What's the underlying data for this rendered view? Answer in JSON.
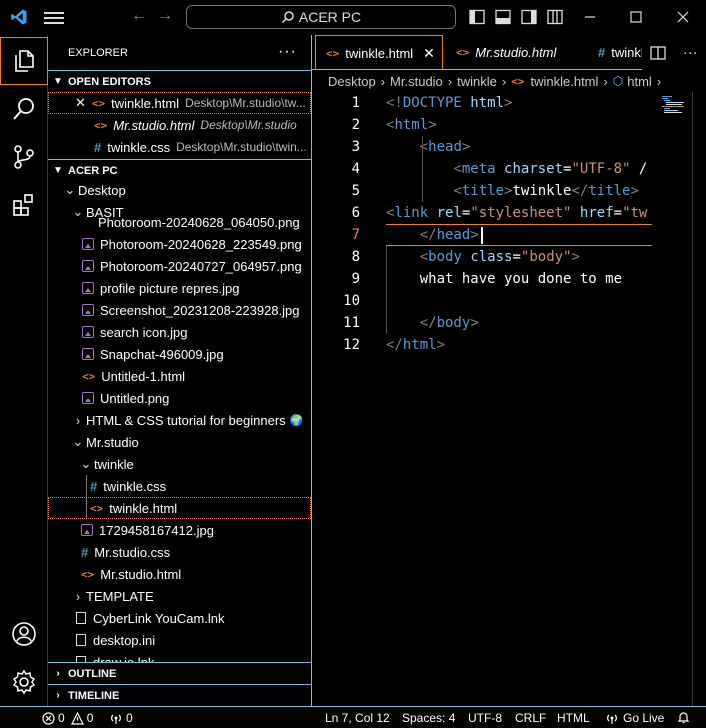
{
  "titlebar": {
    "search_text": "ACER PC"
  },
  "sidebar": {
    "title": "EXPLORER",
    "more": "···",
    "open_editors_label": "OPEN EDITORS",
    "open_editors": [
      {
        "name": "twinkle.html",
        "path": "Desktop\\Mr.studio\\tw...",
        "type": "html",
        "close": "✕"
      },
      {
        "name": "Mr.studio.html",
        "path": "Desktop\\Mr.studio",
        "type": "html"
      },
      {
        "name": "twinkle.css",
        "path": "Desktop\\Mr.studio\\twin...",
        "type": "css"
      }
    ],
    "workspace_label": "ACER PC",
    "tree": {
      "desktop": "Desktop",
      "basit": "BASIT",
      "basit_cut": "Photoroom-20240628_064050.png",
      "files1": [
        {
          "name": "Photoroom-20240628_223549.png",
          "type": "img"
        },
        {
          "name": "Photoroom-20240727_064957.png",
          "type": "img"
        },
        {
          "name": "profile picture repres.jpg",
          "type": "img"
        },
        {
          "name": "Screenshot_20231208-223928.jpg",
          "type": "img"
        },
        {
          "name": "search icon.jpg",
          "type": "img"
        },
        {
          "name": "Snapchat-496009.jpg",
          "type": "img"
        },
        {
          "name": "Untitled-1.html",
          "type": "html"
        },
        {
          "name": "Untitled.png",
          "type": "img"
        }
      ],
      "html_css_folder": "HTML & CSS tutorial for beginners",
      "globe": "🌍",
      "mrstudio": "Mr.studio",
      "twinkle_folder": "twinkle",
      "twinkle_css": "twinkle.css",
      "twinkle_html": "twinkle.html",
      "files2": [
        {
          "name": "1729458167412.jpg",
          "type": "img"
        },
        {
          "name": "Mr.studio.css",
          "type": "css"
        },
        {
          "name": "Mr.studio.html",
          "type": "html"
        }
      ],
      "template": "TEMPLATE",
      "files3": [
        {
          "name": "CyberLink YouCam.lnk",
          "type": "lnk"
        },
        {
          "name": "desktop.ini",
          "type": "ini"
        },
        {
          "name": "draw.io.lnk",
          "type": "lnk"
        }
      ]
    },
    "outline_label": "OUTLINE",
    "timeline_label": "TIMELINE"
  },
  "tabs": [
    {
      "label": "twinkle.html",
      "active": true,
      "close": "✕"
    },
    {
      "label": "Mr.studio.html",
      "active": false
    },
    {
      "label": "twinkle.css",
      "active": false
    }
  ],
  "breadcrumb": [
    "Desktop",
    "Mr.studio",
    "twinkle",
    "twinkle.html",
    "html"
  ],
  "breadcrumb_sep": "›",
  "editor": {
    "line_numbers": [
      "1",
      "2",
      "3",
      "4",
      "5",
      "6",
      "7",
      "8",
      "9",
      "10",
      "11",
      "12"
    ],
    "current_line": 7,
    "lines": [
      [
        [
          "br",
          "<!"
        ],
        [
          "tag",
          "DOCTYPE "
        ],
        [
          "attr",
          "html"
        ],
        [
          "br",
          ">"
        ]
      ],
      [
        [
          "br",
          "<"
        ],
        [
          "tag",
          "html"
        ],
        [
          "br",
          ">"
        ]
      ],
      [
        [
          "txt",
          "    "
        ],
        [
          "br",
          "<"
        ],
        [
          "tag",
          "head"
        ],
        [
          "br",
          ">"
        ]
      ],
      [
        [
          "txt",
          "        "
        ],
        [
          "br",
          "<"
        ],
        [
          "tag",
          "meta "
        ],
        [
          "attr",
          "charset"
        ],
        [
          "txt",
          "="
        ],
        [
          "str",
          "\"UTF-8\""
        ],
        [
          "txt",
          " /"
        ]
      ],
      [
        [
          "txt",
          "        "
        ],
        [
          "br",
          "<"
        ],
        [
          "tag",
          "title"
        ],
        [
          "br",
          ">"
        ],
        [
          "txt",
          "twinkle"
        ],
        [
          "br",
          "</"
        ],
        [
          "tag",
          "title"
        ],
        [
          "br",
          ">"
        ]
      ],
      [
        [
          "br",
          "<"
        ],
        [
          "tag",
          "link "
        ],
        [
          "attr",
          "rel"
        ],
        [
          "txt",
          "="
        ],
        [
          "str",
          "\"stylesheet\""
        ],
        [
          "txt",
          " "
        ],
        [
          "attr",
          "href"
        ],
        [
          "txt",
          "="
        ],
        [
          "str",
          "\"tw"
        ]
      ],
      [
        [
          "txt",
          "    "
        ],
        [
          "br",
          "</"
        ],
        [
          "tag",
          "head"
        ],
        [
          "br",
          ">"
        ]
      ],
      [
        [
          "txt",
          "    "
        ],
        [
          "br",
          "<"
        ],
        [
          "tag",
          "body "
        ],
        [
          "attr",
          "class"
        ],
        [
          "txt",
          "="
        ],
        [
          "str",
          "\"body\""
        ],
        [
          "br",
          ">"
        ]
      ],
      [
        [
          "txt",
          "    what have you done to me"
        ]
      ],
      [
        [
          "txt",
          ""
        ]
      ],
      [
        [
          "txt",
          "    "
        ],
        [
          "br",
          "</"
        ],
        [
          "tag",
          "body"
        ],
        [
          "br",
          ">"
        ]
      ],
      [
        [
          "br",
          "</"
        ],
        [
          "tag",
          "html"
        ],
        [
          "br",
          ">"
        ]
      ]
    ]
  },
  "statusbar": {
    "errors": "0",
    "warnings": "0",
    "ports": "0",
    "position": "Ln 7, Col 12",
    "spaces": "Spaces: 4",
    "encoding": "UTF-8",
    "eol": "CRLF",
    "language": "HTML",
    "golive": "Go Live"
  },
  "colors": {
    "accent_border": "#f38518",
    "focus_border": "#6fc3df",
    "html_icon": "#e37933",
    "css_icon": "#519aba",
    "img_icon": "#a074c4"
  }
}
